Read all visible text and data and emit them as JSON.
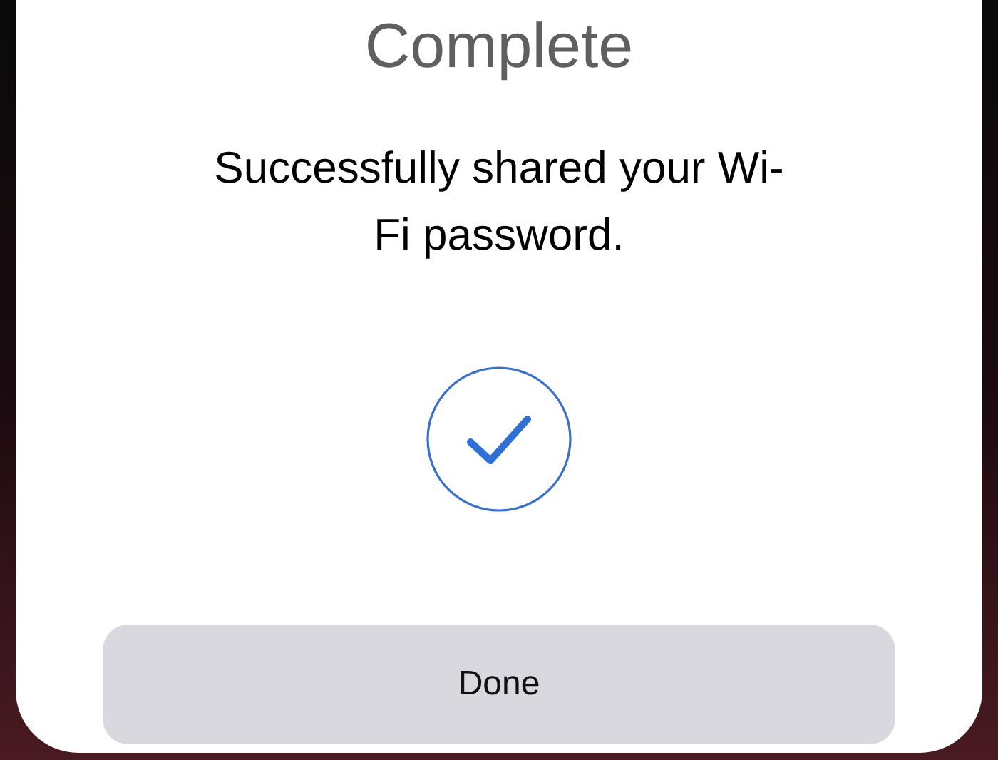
{
  "dialog": {
    "title": "Complete",
    "message": "Successfully shared your Wi-Fi password.",
    "button": "Done"
  }
}
